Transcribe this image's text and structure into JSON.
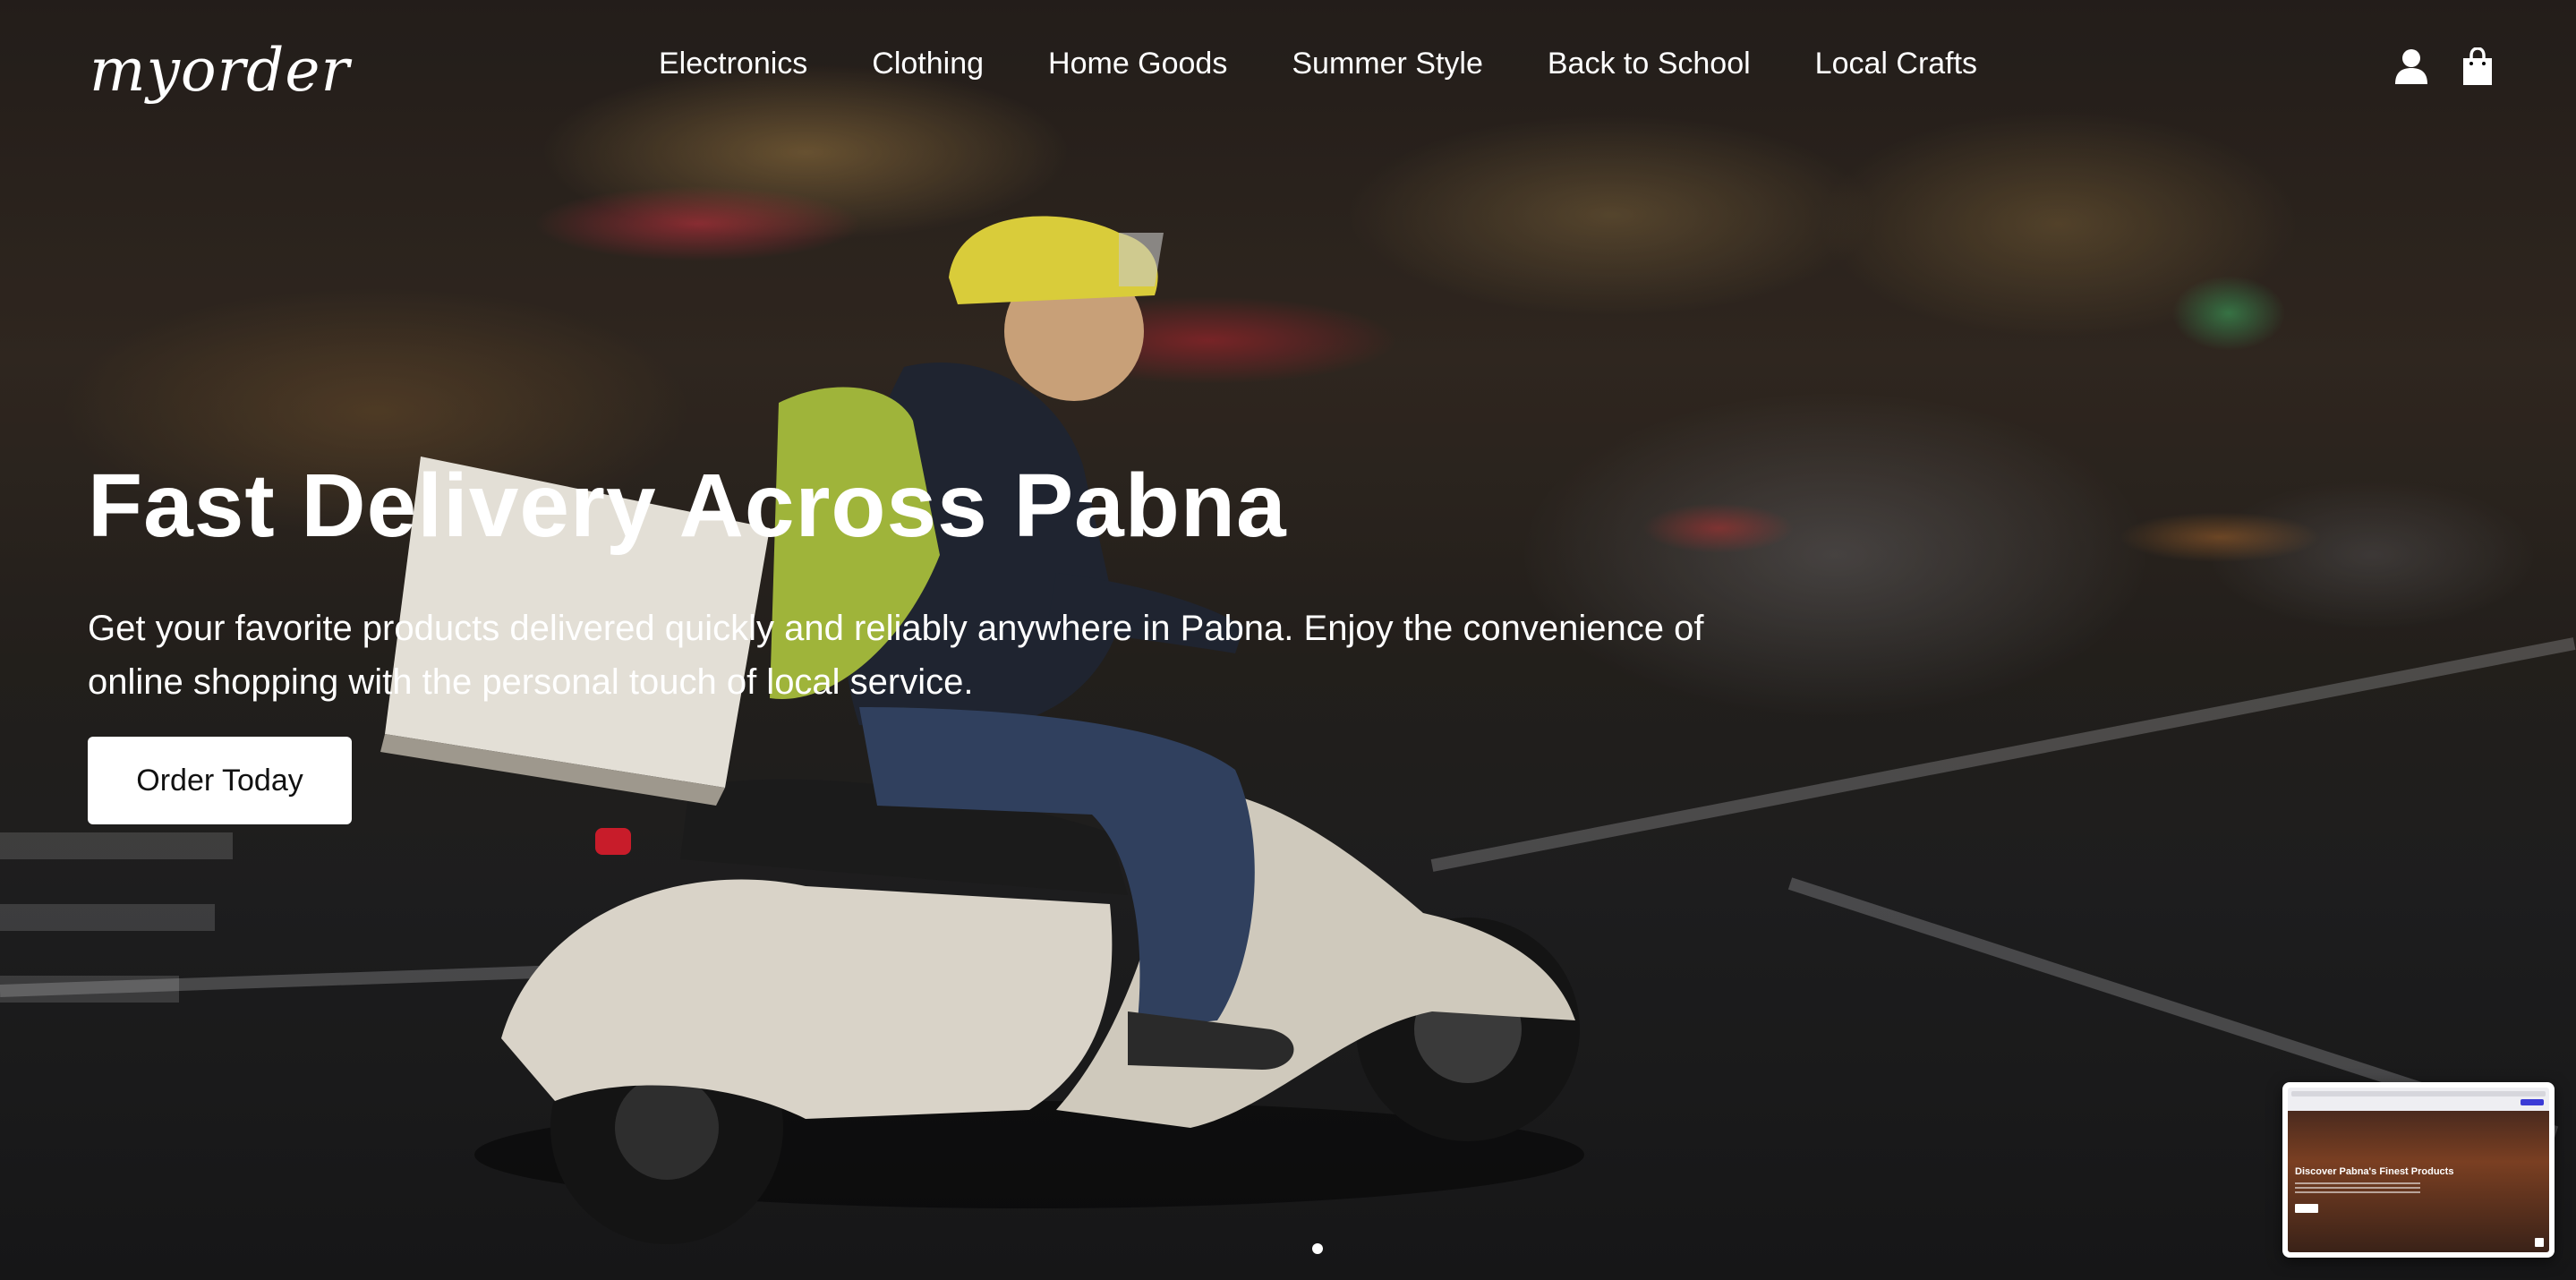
{
  "brand": {
    "logo_text": "myorder"
  },
  "nav": {
    "items": [
      {
        "label": "Electronics"
      },
      {
        "label": "Clothing"
      },
      {
        "label": "Home Goods"
      },
      {
        "label": "Summer Style"
      },
      {
        "label": "Back to School"
      },
      {
        "label": "Local Crafts"
      }
    ]
  },
  "header_icons": {
    "account": "user-icon",
    "cart": "shopping-bag-icon"
  },
  "hero": {
    "headline": "Fast Delivery Across Pabna",
    "subline": "Get your favorite products delivered quickly and reliably anywhere in Pabna. Enjoy the convenience of online shopping with the personal touch of local service.",
    "cta_label": "Order Today",
    "slide_count": 1,
    "active_slide": 1
  },
  "preview_thumbnail": {
    "title": "Discover Pabna's Finest Products"
  },
  "colors": {
    "text": "#ffffff",
    "button_bg": "#ffffff",
    "button_text": "#111111"
  }
}
